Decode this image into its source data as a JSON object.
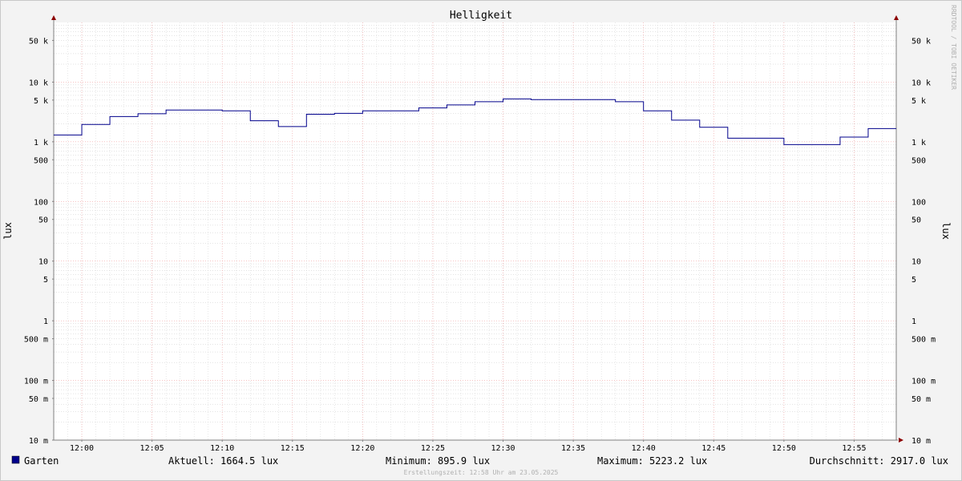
{
  "chart_data": {
    "type": "line",
    "title": "Helligkeit",
    "ylabel": "lux",
    "yscale": "log",
    "ylim": [
      0.01,
      100000
    ],
    "xlim": [
      "11:58",
      "12:58"
    ],
    "x_ticks": [
      "12:00",
      "12:05",
      "12:10",
      "12:15",
      "12:20",
      "12:25",
      "12:30",
      "12:35",
      "12:40",
      "12:45",
      "12:50",
      "12:55"
    ],
    "y_ticks": [
      {
        "value": 50000,
        "label": "50 k"
      },
      {
        "value": 10000,
        "label": "10 k"
      },
      {
        "value": 5000,
        "label": "5 k"
      },
      {
        "value": 1000,
        "label": "1 k"
      },
      {
        "value": 500,
        "label": "500"
      },
      {
        "value": 100,
        "label": "100"
      },
      {
        "value": 50,
        "label": "50"
      },
      {
        "value": 10,
        "label": "10"
      },
      {
        "value": 5,
        "label": "5"
      },
      {
        "value": 1,
        "label": "1"
      },
      {
        "value": 0.5,
        "label": "500 m"
      },
      {
        "value": 0.1,
        "label": "100 m"
      },
      {
        "value": 0.05,
        "label": "50 m"
      },
      {
        "value": 0.01,
        "label": "10 m"
      }
    ],
    "series": [
      {
        "name": "Garten",
        "color": "#00008b",
        "step": true,
        "x": [
          "11:58",
          "12:00",
          "12:02",
          "12:04",
          "12:06",
          "12:10",
          "12:12",
          "12:14",
          "12:16",
          "12:18",
          "12:20",
          "12:24",
          "12:26",
          "12:28",
          "12:30",
          "12:32",
          "12:38",
          "12:40",
          "12:42",
          "12:44",
          "12:46",
          "12:50",
          "12:54",
          "12:56",
          "12:58"
        ],
        "values": [
          1300,
          1950,
          2650,
          2950,
          3400,
          3300,
          2250,
          1800,
          2900,
          3000,
          3300,
          3700,
          4150,
          4700,
          5223.2,
          5100,
          4700,
          3300,
          2300,
          1750,
          1150,
          895.9,
          1200,
          1664.5,
          1664.5
        ]
      }
    ],
    "grid": true,
    "legend_position": "bottom-left"
  },
  "legend": {
    "series_label": "Garten",
    "color": "#00008b",
    "current": "Aktuell: 1664.5 lux",
    "minimum": "Minimum: 895.9 lux",
    "maximum": "Maximum: 5223.2 lux",
    "average": "Durchschnitt: 2917.0 lux"
  },
  "footer": "Erstellungszeit: 12:58 Uhr am 23.05.2025",
  "watermark": "RRDTOOL / TOBI OETIKER"
}
